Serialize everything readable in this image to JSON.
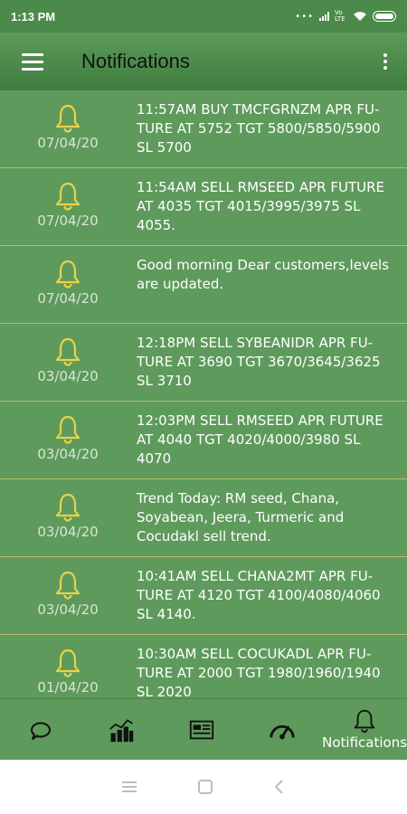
{
  "status_bar": {
    "time": "1:13 PM",
    "network_label": "Vo LTE"
  },
  "app_bar": {
    "title": "Notifications",
    "menu_icon": "hamburger-menu-icon",
    "overflow_icon": "more-vert-icon"
  },
  "notifications": [
    {
      "date": "07/04/20",
      "message": "11:57AM BUY TMCFGRNZM APR FU-TURE AT 5752 TGT 5800/5850/5900 SL 5700"
    },
    {
      "date": "07/04/20",
      "message": "11:54AM SELL RMSEED APR FUTURE AT 4035 TGT 4015/3995/3975 SL 4055."
    },
    {
      "date": "07/04/20",
      "message": "Good morning Dear customers,levels are updated."
    },
    {
      "date": "03/04/20",
      "message": "12:18PM SELL SYBEANIDR APR FU-TURE AT 3690 TGT 3670/3645/3625 SL 3710"
    },
    {
      "date": "03/04/20",
      "message": "12:03PM SELL RMSEED APR FUTURE AT 4040 TGT 4020/4000/3980 SL 4070"
    },
    {
      "date": "03/04/20",
      "message": "Trend Today: RM seed, Chana, Soyabean, Jeera, Turmeric and Cocudakl sell trend."
    },
    {
      "date": "03/04/20",
      "message": "10:41AM SELL CHANA2MT APR FU-TURE AT 4120 TGT 4100/4080/4060 SL 4140."
    },
    {
      "date": "01/04/20",
      "message": "10:30AM SELL COCUKADL APR FU-TURE AT 2000 TGT 1980/1960/1940 SL 2020"
    }
  ],
  "bottom_nav": {
    "items": [
      {
        "icon": "chat-icon",
        "label": ""
      },
      {
        "icon": "chart-icon",
        "label": ""
      },
      {
        "icon": "news-icon",
        "label": ""
      },
      {
        "icon": "speedometer-icon",
        "label": ""
      },
      {
        "icon": "bell-icon",
        "label": "Notifications"
      }
    ]
  },
  "colors": {
    "status_bar": "#4b8a4a",
    "app_bar": "#4f8c4e",
    "list_background": "#5e9a5c",
    "divider": "#b9b866",
    "bell_icon": "#e9d24a"
  }
}
